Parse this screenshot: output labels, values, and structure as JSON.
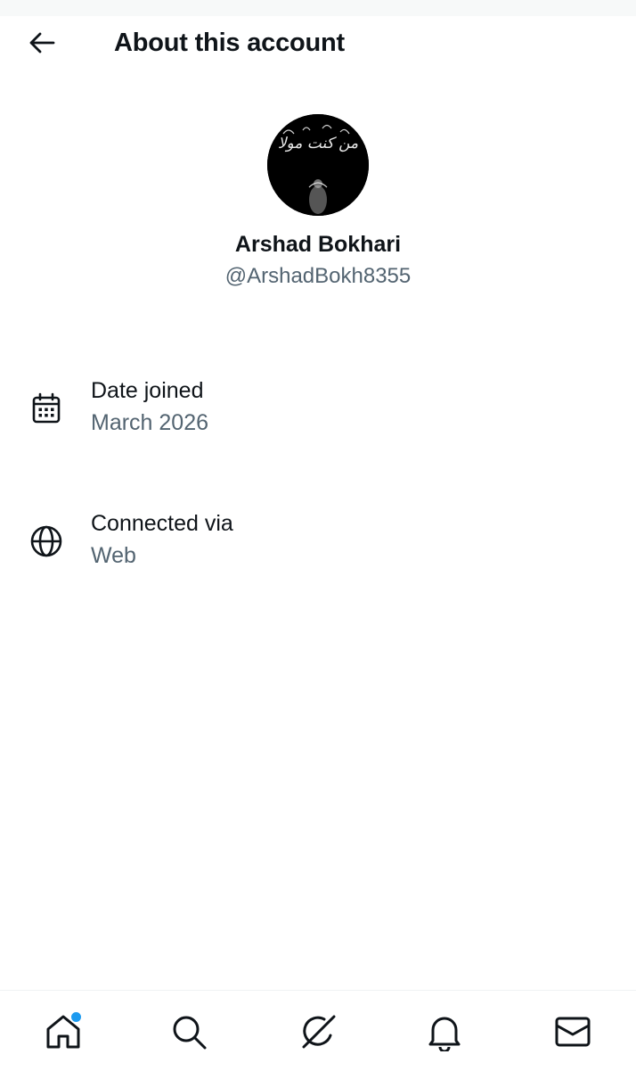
{
  "header": {
    "title": "About this account",
    "back_icon": "arrow-left-icon"
  },
  "profile": {
    "display_name": "Arshad Bokhari",
    "handle": "@ArshadBokh8355",
    "avatar_text": "من كنت مولا"
  },
  "details": [
    {
      "icon": "calendar-icon",
      "label": "Date joined",
      "value": "March 2026"
    },
    {
      "icon": "globe-icon",
      "label": "Connected via",
      "value": "Web"
    }
  ],
  "bottom_nav": {
    "items": [
      {
        "icon": "home-icon",
        "has_notification_dot": true
      },
      {
        "icon": "search-icon"
      },
      {
        "icon": "grok-icon"
      },
      {
        "icon": "bell-icon"
      },
      {
        "icon": "mail-icon"
      }
    ]
  },
  "colors": {
    "text_primary": "#0f1419",
    "text_secondary": "#536471",
    "accent_dot": "#1d9bf0"
  }
}
